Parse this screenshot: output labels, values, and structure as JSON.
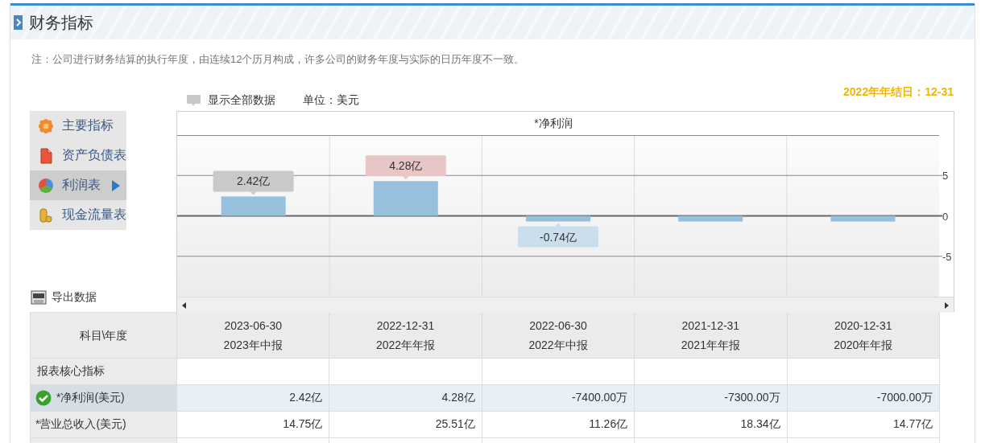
{
  "header": {
    "title": "财务指标"
  },
  "note": "注：公司进行财务结算的执行年度，由连续12个历月构成，许多公司的财务年度与实际的日历年度不一致。",
  "toolbar": {
    "show_all": "显示全部数据",
    "unit": "单位：美元"
  },
  "fiscal_year_end": "2022年年结日：12-31",
  "menu": [
    {
      "label": "主要指标",
      "kind": "flower",
      "selected": false
    },
    {
      "label": "资产负债表",
      "kind": "document",
      "selected": false
    },
    {
      "label": "利润表",
      "kind": "pie",
      "selected": true
    },
    {
      "label": "现金流量表",
      "kind": "coins",
      "selected": false
    }
  ],
  "export": "导出数据",
  "chart": {
    "bar_labels": [
      {
        "text": "2.42亿",
        "selected": false
      },
      {
        "text": "4.28亿",
        "selected": true
      },
      {
        "text": "-0.74亿",
        "selected": false
      }
    ],
    "chart_data": {
      "type": "bar",
      "title": "*净利润",
      "values": [
        2.4,
        4.3,
        -0.7,
        -0.7,
        -0.7
      ],
      "ylim": [
        -10,
        10
      ],
      "yticks": [
        -5,
        0,
        5
      ]
    }
  },
  "table": {
    "corner": "科目\\年度",
    "columns": [
      {
        "date": "2023-06-30",
        "period": "2023年中报"
      },
      {
        "date": "2022-12-31",
        "period": "2022年年报"
      },
      {
        "date": "2022-06-30",
        "period": "2022年中报"
      },
      {
        "date": "2021-12-31",
        "period": "2021年年报"
      },
      {
        "date": "2020-12-31",
        "period": "2020年年报"
      }
    ],
    "rows": [
      {
        "kind": "section",
        "label": "报表核心指标",
        "selected": false
      },
      {
        "kind": "data",
        "label": "*净利润(美元)",
        "selected": true,
        "cells": [
          "2.42亿",
          "4.28亿",
          "-7400.00万",
          "-7300.00万",
          "-7000.00万"
        ]
      },
      {
        "kind": "data",
        "label": "*营业总收入(美元)",
        "selected": false,
        "cells": [
          "14.75亿",
          "25.51亿",
          "11.26亿",
          "18.34亿",
          "14.77亿"
        ]
      },
      {
        "kind": "blank",
        "selected": false
      }
    ]
  }
}
